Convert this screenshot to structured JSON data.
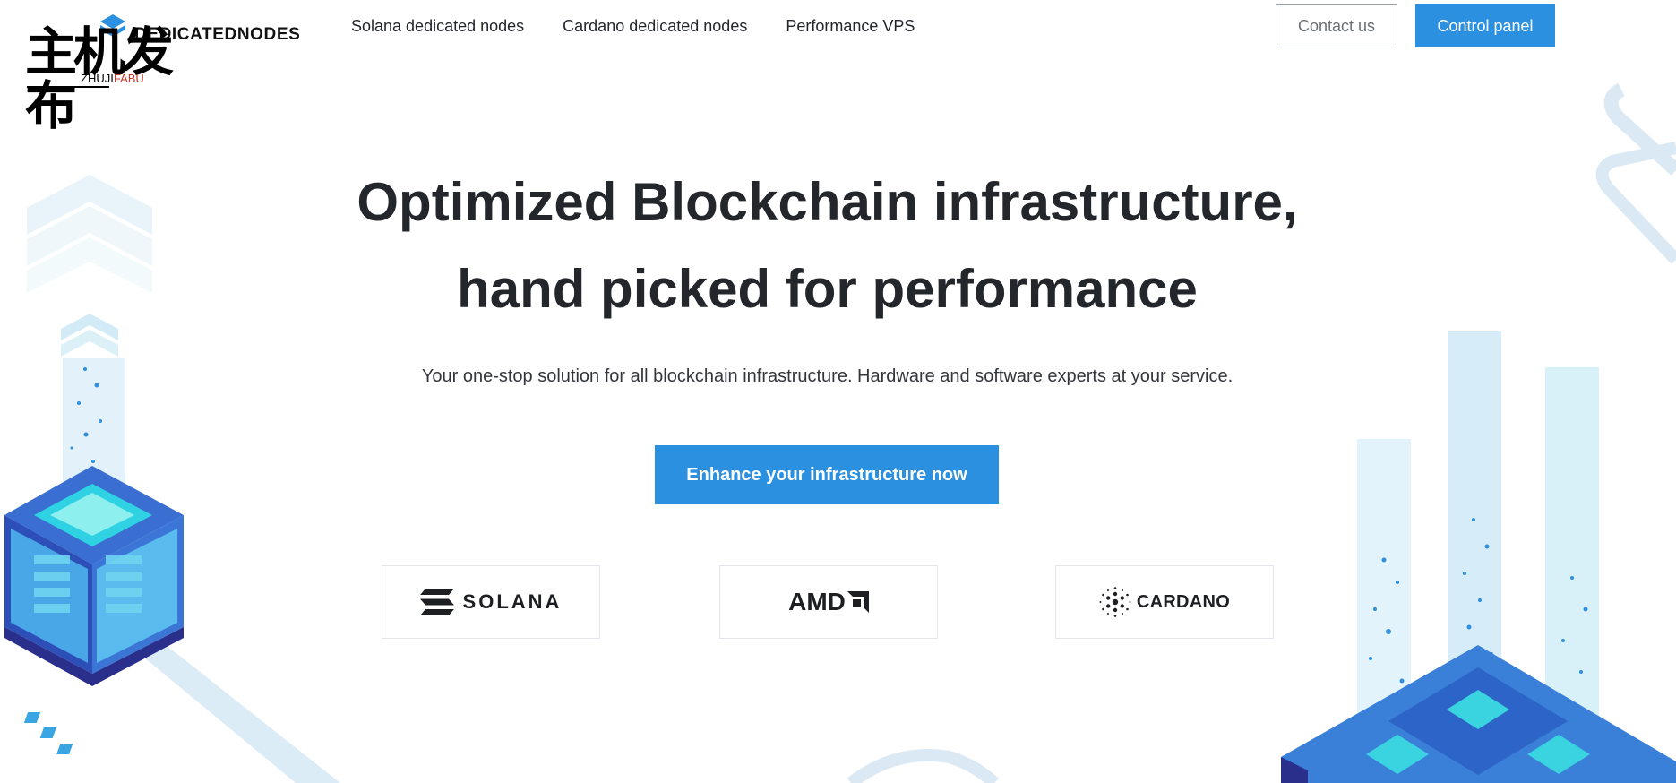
{
  "watermark": {
    "chinese": "主机发布",
    "latin_black": "ZHUJI",
    "latin_red": "FABU"
  },
  "brand": {
    "name": "DEDICATEDNODES"
  },
  "nav": {
    "items": [
      {
        "label": "Solana dedicated nodes"
      },
      {
        "label": "Cardano dedicated nodes"
      },
      {
        "label": "Performance VPS"
      }
    ]
  },
  "header_actions": {
    "contact_label": "Contact us",
    "panel_label": "Control panel"
  },
  "hero": {
    "title_line1": "Optimized Blockchain infrastructure,",
    "title_line2": "hand picked for performance",
    "subtitle": "Your one-stop solution for all blockchain infrastructure. Hardware and software experts at your service.",
    "cta_label": "Enhance your infrastructure now"
  },
  "partners": [
    {
      "name": "SOLANA",
      "icon": "solana-logo-icon"
    },
    {
      "name": "AMD",
      "icon": "amd-arrow-icon"
    },
    {
      "name": "CARDANO",
      "icon": "cardano-logo-icon"
    }
  ],
  "colors": {
    "accent": "#2b90e0",
    "text": "#23262b",
    "border": "#e3e6ea"
  }
}
